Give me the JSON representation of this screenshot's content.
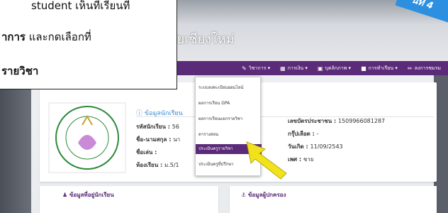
{
  "callout": {
    "line1": "student  เห็นที่เรียนที่",
    "line2_bold": "าการ",
    "line2_rest": " และกดเลือกที่",
    "line3": "รายวิชา"
  },
  "corner_badge": "นที่ 4",
  "site": {
    "title": "ยาลัยเชียงใหม่",
    "subtitle": "r"
  },
  "navbar": {
    "items": [
      {
        "icon": "book-icon",
        "label": "วิชาการ ▾"
      },
      {
        "icon": "money-icon",
        "label": "การเงิน ▾"
      },
      {
        "icon": "health-icon",
        "label": "บุคลิกภาพ ▾"
      },
      {
        "icon": "school-icon",
        "label": "การทำเรียน ▾"
      },
      {
        "icon": "pencil-icon",
        "label": "ลงการชมรม"
      }
    ]
  },
  "dropdown": {
    "items": [
      "ระบบลงทะเบียนออนไลน์",
      "ผลการเรียน GPA",
      "ผลการเรียนแยกรายวิชา",
      "ตารางสอน",
      "ประเมินครูรายวิชา",
      "ประเมินครูที่ปรึกษา"
    ],
    "active_index": 4
  },
  "student": {
    "section_title": "ข้อมูลนักเรียน",
    "id_label": "รหัสนักเรียน :",
    "id_value": "56",
    "name_label": "ชื่อ-นามสกุล :",
    "name_value": "นา",
    "nickname_label": "ชื่อเล่น :",
    "room_label": "ห้องเรียน :",
    "room_value": "ม.5/1",
    "citizen_label": "เลขบัตรประชาชน :",
    "citizen_value": "1509966081287",
    "blood_label": "กรุ๊ปเลือด :",
    "blood_value": "-",
    "dob_label": "วันเกิด :",
    "dob_value": "11/09/2543",
    "sex_label": "เพศ :",
    "sex_value": "ชาย"
  },
  "bottom": {
    "left_label": "ข้อมูลที่อยู่นักเรียน",
    "right_label": "ข้อมูลผู้ปกครอง"
  },
  "logo_text": "วิชชา มรรค ครู",
  "colors": {
    "nav": "#5b2a78",
    "accent": "#3a8cd0",
    "arrow": "#f2e21b"
  }
}
